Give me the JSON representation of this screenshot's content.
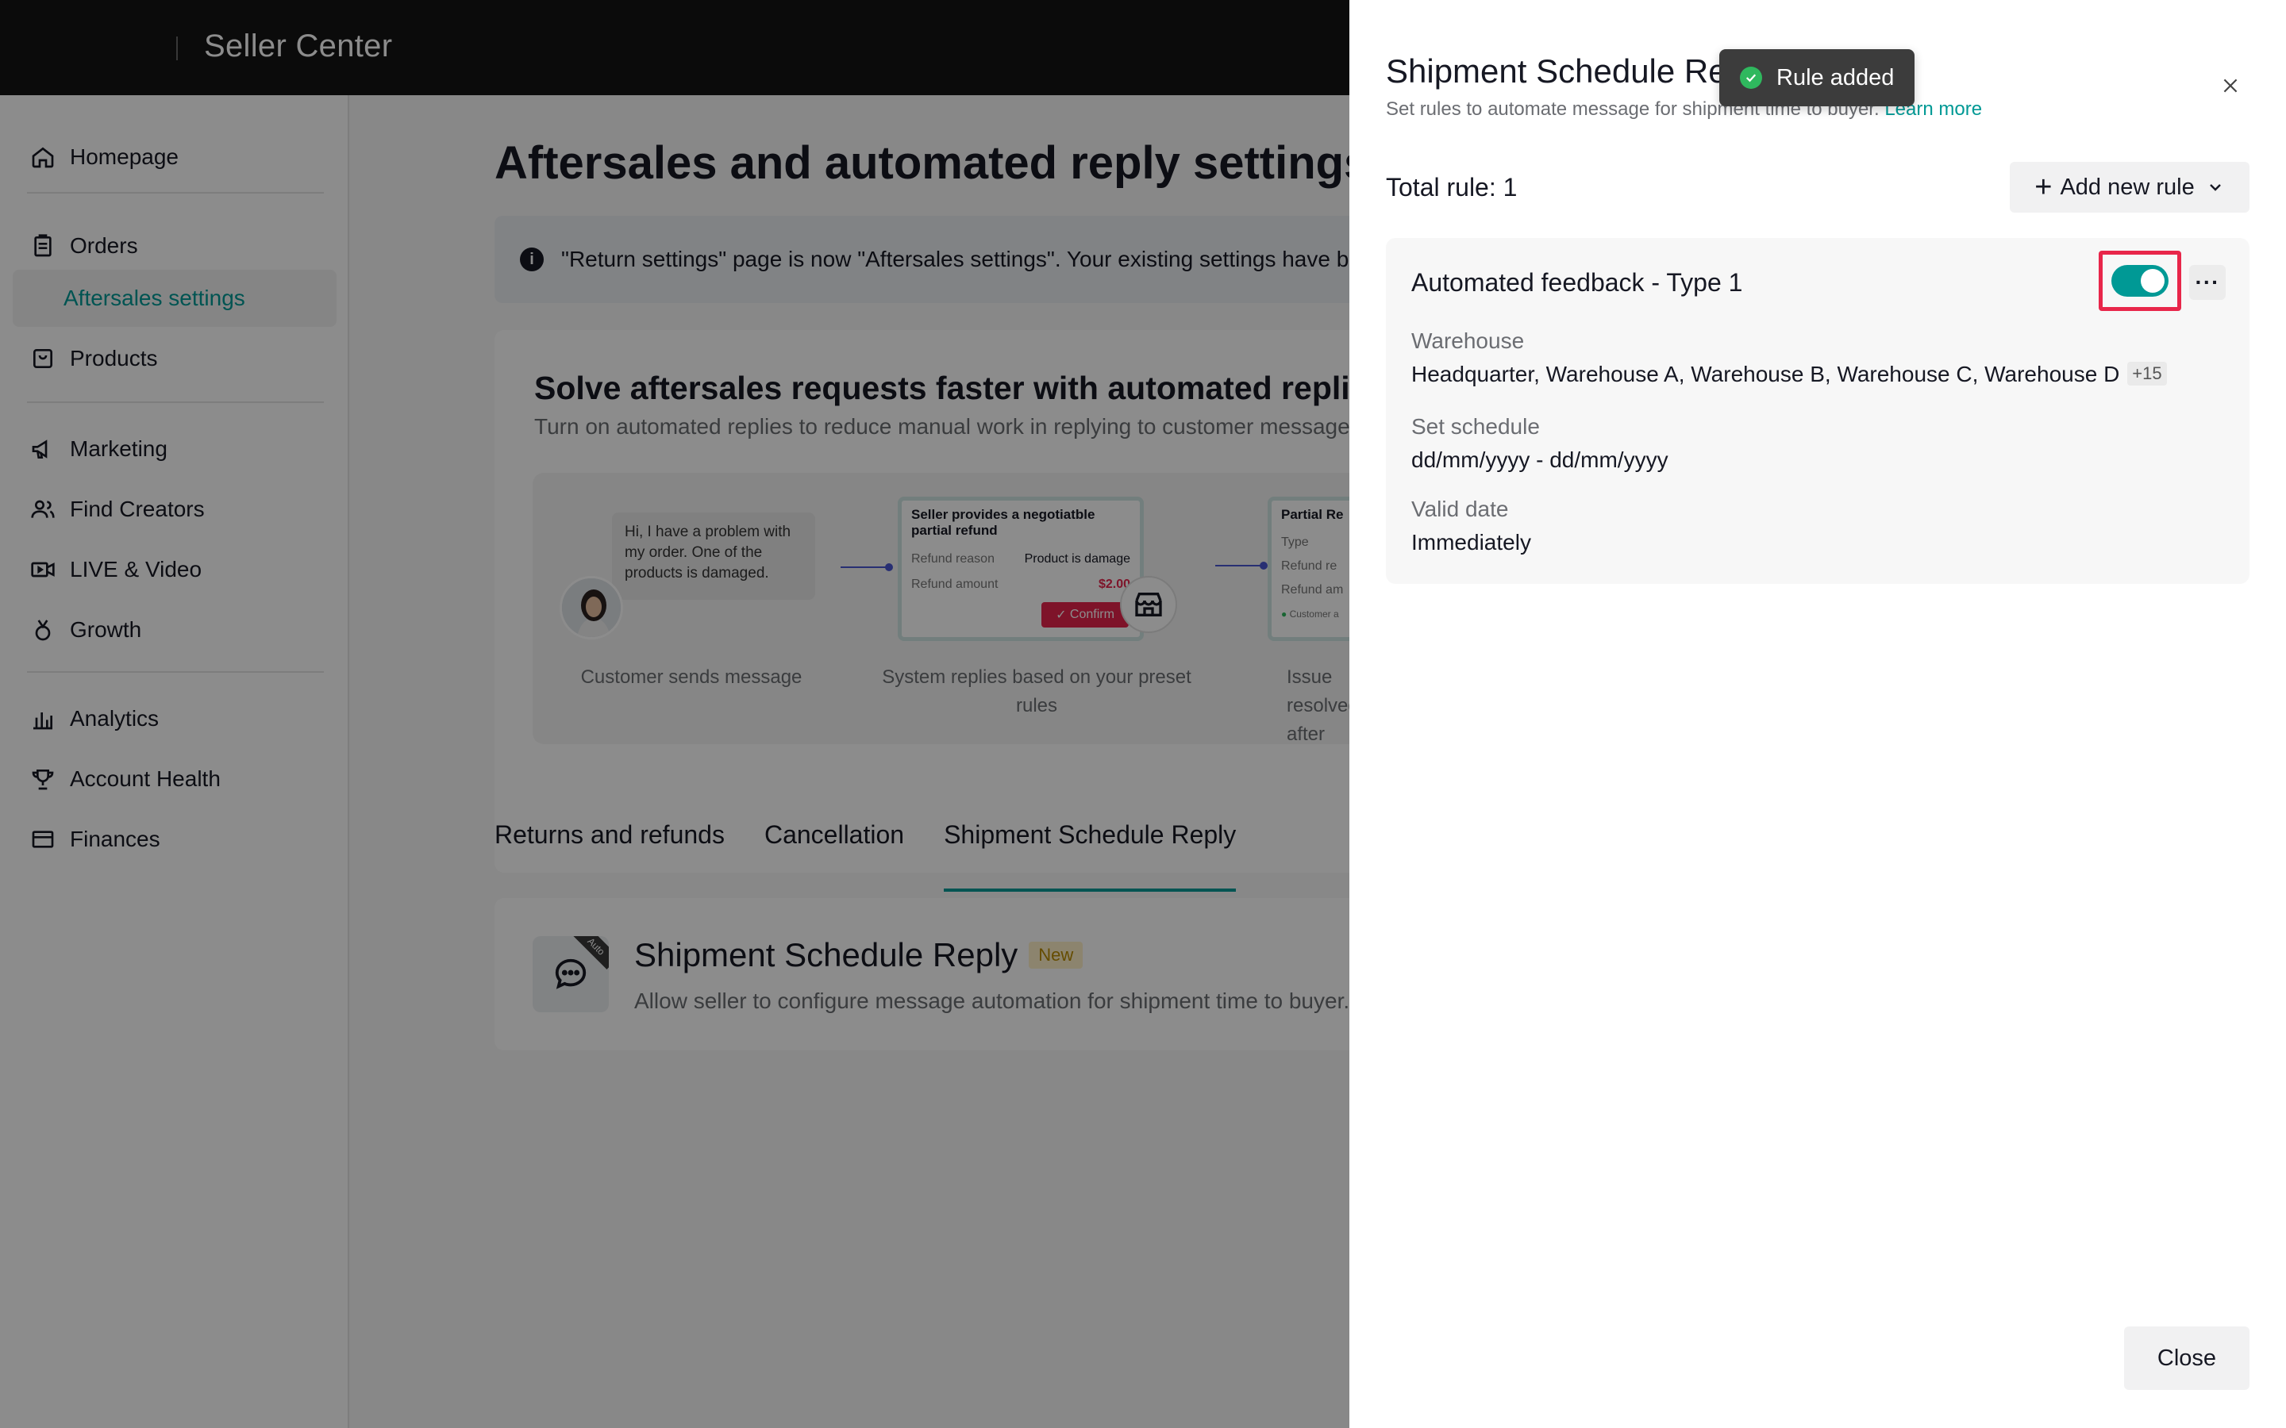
{
  "topbar": {
    "brand": "Seller Center"
  },
  "sidebar": {
    "items": [
      {
        "label": "Homepage",
        "icon": "home-icon"
      },
      {
        "label": "Orders",
        "icon": "clipboard-icon"
      },
      {
        "label": "Aftersales settings",
        "icon": ""
      },
      {
        "label": "Products",
        "icon": "box-icon"
      },
      {
        "label": "Marketing",
        "icon": "megaphone-icon"
      },
      {
        "label": "Find Creators",
        "icon": "users-icon"
      },
      {
        "label": "LIVE & Video",
        "icon": "video-icon"
      },
      {
        "label": "Growth",
        "icon": "medal-icon"
      },
      {
        "label": "Analytics",
        "icon": "bar-chart-icon"
      },
      {
        "label": "Account Health",
        "icon": "trophy-icon"
      },
      {
        "label": "Finances",
        "icon": "wallet-icon"
      }
    ]
  },
  "main": {
    "title": "Aftersales and automated reply settings",
    "notice": "\"Return settings\" page is now \"Aftersales settings\". Your existing settings have been kept.",
    "promo": {
      "heading": "Solve aftersales requests faster with automated replies",
      "subheading": "Turn on automated replies to reduce manual work in replying to customer messages.",
      "bubble": "Hi, I have a problem with my order. One of the products is damaged.",
      "step1_caption": "Customer sends message",
      "step2_caption": "System replies based on your preset rules",
      "step3_caption": "Issue resolved after",
      "mini1": {
        "title": "Seller provides a negotiatble partial refund",
        "reason_label": "Refund reason",
        "reason_value": "Product is damage",
        "amount_label": "Refund amount",
        "amount_value": "$2.00",
        "confirm": "Confirm"
      },
      "mini2": {
        "title": "Partial Re",
        "type_label": "Type",
        "refund_re": "Refund re",
        "refund_am": "Refund am",
        "customer": "Customer a"
      }
    },
    "tabs": [
      {
        "label": "Returns and refunds"
      },
      {
        "label": "Cancellation"
      },
      {
        "label": "Shipment Schedule Reply"
      }
    ],
    "feature": {
      "corner": "Auto",
      "title": "Shipment Schedule Reply",
      "badge": "New",
      "description": "Allow seller to configure message automation for shipment time to buyer."
    }
  },
  "drawer": {
    "title": "Shipment Schedule Reply",
    "subtitle": "Set rules to automate message for shipment time to buyer.",
    "learn_more": "Learn more",
    "total": "Total rule: 1",
    "add_button": "Add new rule",
    "rule": {
      "name": "Automated feedback - Type 1",
      "enabled": true,
      "warehouse_label": "Warehouse",
      "warehouse_value": "Headquarter, Warehouse A, Warehouse B, Warehouse C, Warehouse D",
      "warehouse_more": "+15",
      "schedule_label": "Set schedule",
      "schedule_value": "dd/mm/yyyy - dd/mm/yyyy",
      "valid_label": "Valid date",
      "valid_value": "Immediately"
    },
    "close_button": "Close"
  },
  "toast": {
    "message": "Rule added"
  },
  "colors": {
    "accent": "#009995",
    "highlight": "#e8264a",
    "success": "#2fb85e"
  }
}
